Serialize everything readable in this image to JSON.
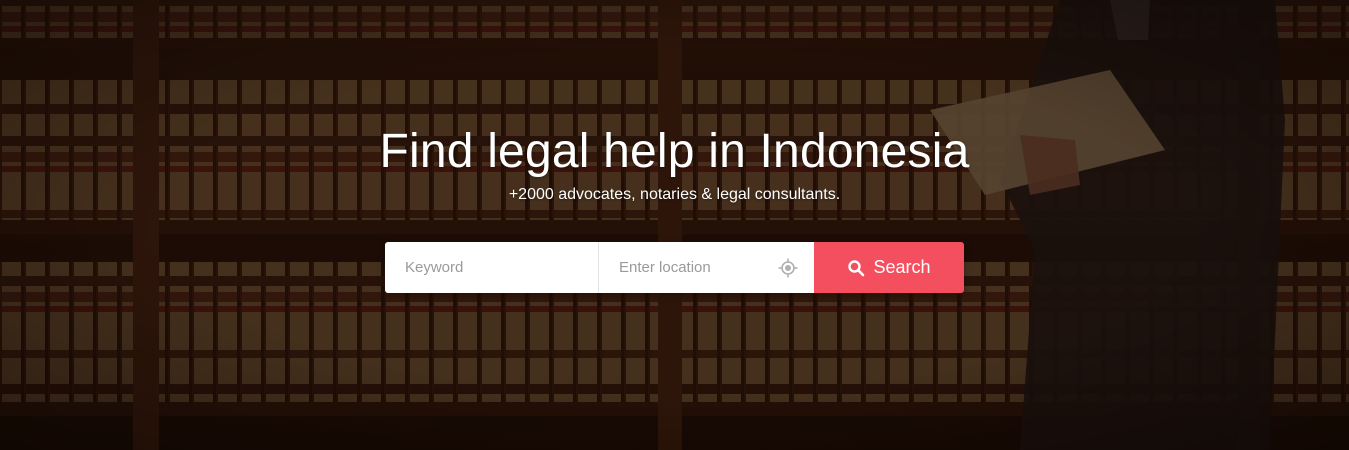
{
  "hero": {
    "title": "Find legal help in Indonesia",
    "subtitle": "+2000 advocates, notaries & legal consultants."
  },
  "search": {
    "keyword_placeholder": "Keyword",
    "location_placeholder": "Enter location",
    "button_label": "Search",
    "button_color": "#f34f5f"
  },
  "icons": {
    "search": "search-icon",
    "locate": "crosshair-icon"
  }
}
